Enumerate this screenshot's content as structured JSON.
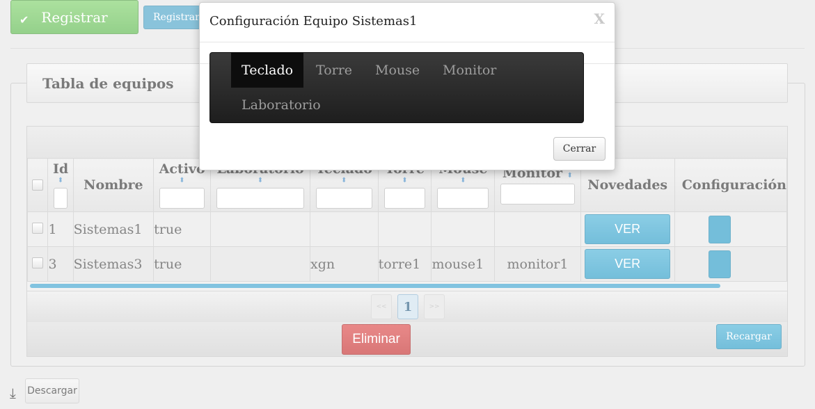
{
  "page": {
    "register_button": "Registrar",
    "register_button_2": "Registrar",
    "table_title": "Tabla de equipos",
    "download_label": "Descargar"
  },
  "grid": {
    "headers": [
      "Id",
      "Nombre",
      "Activo",
      "Laboratorio",
      "Teclado",
      "Torre",
      "Mouse",
      "Monitor",
      "Novedades",
      "Configuración"
    ],
    "rows": [
      {
        "id": "1",
        "nombre": "Sistemas1",
        "activo": "true",
        "laboratorio": "",
        "teclado": "",
        "torre": "",
        "mouse": "",
        "monitor": "",
        "novedades": "VER"
      },
      {
        "id": "3",
        "nombre": "Sistemas3",
        "activo": "true",
        "laboratorio": "",
        "teclado": "xgn",
        "torre": "torre1",
        "mouse": "mouse1",
        "monitor": "monitor1",
        "novedades": "VER"
      }
    ],
    "pager": {
      "first": "<<",
      "prev": "<",
      "current_page": "1",
      "next": ">",
      "last": ">>"
    },
    "delete_button": "Eliminar",
    "reload_button": "Recargar"
  },
  "modal": {
    "title": "Configuración Equipo Sistemas1",
    "close_icon": "X",
    "tabs": [
      {
        "label": "Teclado",
        "active": true
      },
      {
        "label": "Torre",
        "active": false
      },
      {
        "label": "Mouse",
        "active": false
      },
      {
        "label": "Monitor",
        "active": false
      },
      {
        "label": "Laboratorio",
        "active": false
      }
    ],
    "close_button": "Cerrar"
  },
  "colors": {
    "register_green": "#5cb84d",
    "primary_blue": "#2a9cc7",
    "danger_red": "#c42e2e",
    "navbar_dark": "#222222"
  }
}
